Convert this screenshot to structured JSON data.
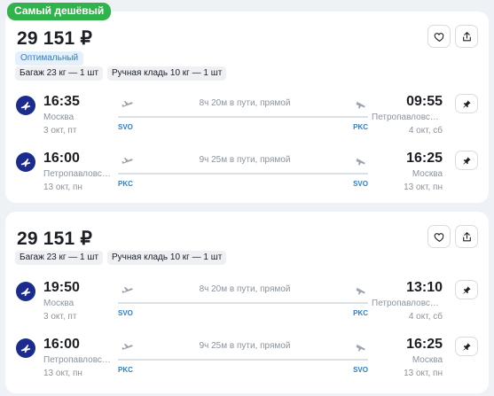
{
  "badge": "Самый дешёвый",
  "colors": {
    "accent": "#2b7fd0",
    "badge_green": "#2fb34a",
    "airline_blue": "#1c2c8e"
  },
  "cards": [
    {
      "price": "29 151 ₽",
      "tag_optimal": "Оптимальный",
      "baggage": "Багаж 23 кг — 1 шт",
      "carry_on": "Ручная кладь 10 кг — 1 шт",
      "segments": [
        {
          "dep_time": "16:35",
          "dep_city": "Москва",
          "dep_date": "3 окт, пт",
          "duration": "8ч 20м в пути, прямой",
          "from_code": "SVO",
          "to_code": "PKC",
          "arr_time": "09:55",
          "arr_city": "Петропавловск-Камчатский",
          "arr_date": "4 окт, сб"
        },
        {
          "dep_time": "16:00",
          "dep_city": "Петропавловск-Камчатский",
          "dep_date": "13 окт, пн",
          "duration": "9ч 25м в пути, прямой",
          "from_code": "PKC",
          "to_code": "SVO",
          "arr_time": "16:25",
          "arr_city": "Москва",
          "arr_date": "13 окт, пн"
        }
      ]
    },
    {
      "price": "29 151 ₽",
      "baggage": "Багаж 23 кг — 1 шт",
      "carry_on": "Ручная кладь 10 кг — 1 шт",
      "segments": [
        {
          "dep_time": "19:50",
          "dep_city": "Москва",
          "dep_date": "3 окт, пт",
          "duration": "8ч 20м в пути, прямой",
          "from_code": "SVO",
          "to_code": "PKC",
          "arr_time": "13:10",
          "arr_city": "Петропавловск-Камчатский",
          "arr_date": "4 окт, сб"
        },
        {
          "dep_time": "16:00",
          "dep_city": "Петропавловск-Камчатский",
          "dep_date": "13 окт, пн",
          "duration": "9ч 25м в пути, прямой",
          "from_code": "PKC",
          "to_code": "SVO",
          "arr_time": "16:25",
          "arr_city": "Москва",
          "arr_date": "13 окт, пн"
        }
      ]
    }
  ]
}
